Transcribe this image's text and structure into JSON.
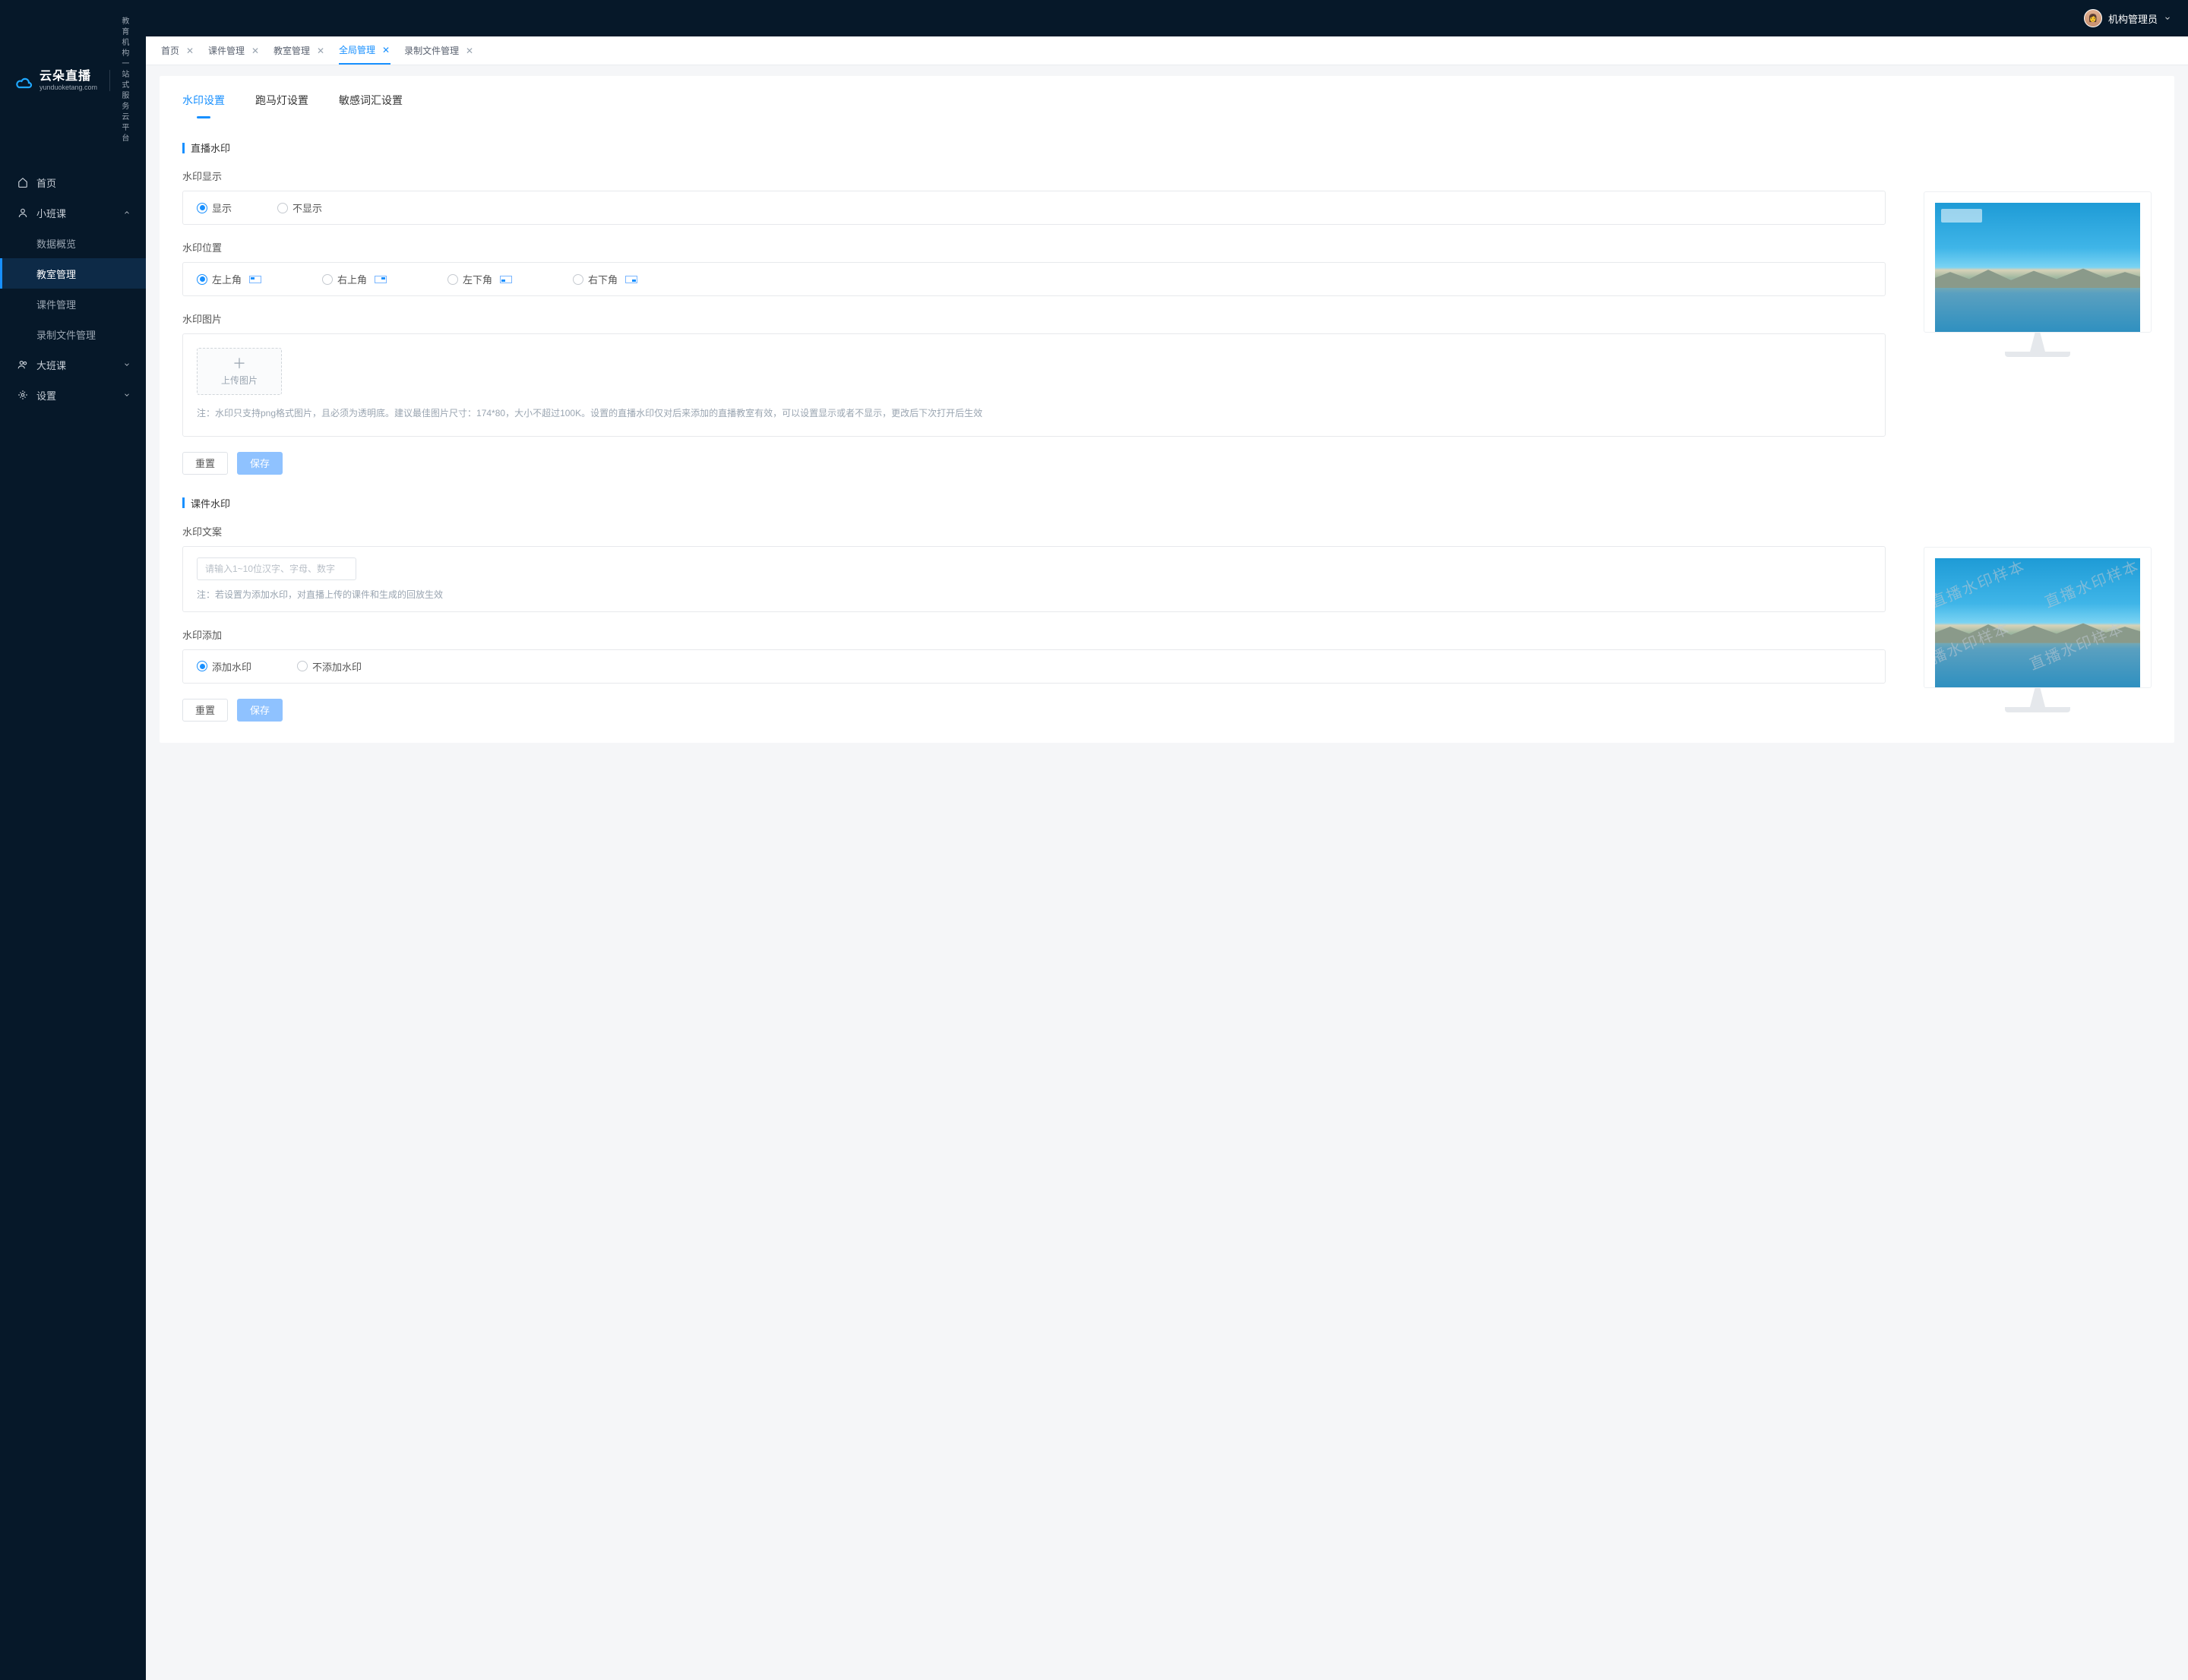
{
  "brand": {
    "name": "云朵直播",
    "domain": "yunduoketang.com",
    "tagline1": "教育机构一站",
    "tagline2": "式服务云平台"
  },
  "user": {
    "name": "机构管理员"
  },
  "sidebar": {
    "items": [
      {
        "label": "首页",
        "icon": "home"
      },
      {
        "label": "小班课",
        "icon": "user",
        "expanded": true,
        "children": [
          {
            "label": "数据概览"
          },
          {
            "label": "教室管理",
            "active": true
          },
          {
            "label": "课件管理"
          },
          {
            "label": "录制文件管理"
          }
        ]
      },
      {
        "label": "大班课",
        "icon": "users",
        "expanded": false
      },
      {
        "label": "设置",
        "icon": "gear",
        "expanded": false
      }
    ]
  },
  "tabs": [
    {
      "label": "首页",
      "active": false
    },
    {
      "label": "课件管理",
      "active": false
    },
    {
      "label": "教室管理",
      "active": false
    },
    {
      "label": "全局管理",
      "active": true
    },
    {
      "label": "录制文件管理",
      "active": false
    }
  ],
  "innerTabs": [
    {
      "label": "水印设置",
      "active": true
    },
    {
      "label": "跑马灯设置",
      "active": false
    },
    {
      "label": "敏感词汇设置",
      "active": false
    }
  ],
  "sections": {
    "live": {
      "title": "直播水印",
      "display": {
        "label": "水印显示",
        "options": [
          "显示",
          "不显示"
        ],
        "selected": 0
      },
      "position": {
        "label": "水印位置",
        "options": [
          "左上角",
          "右上角",
          "左下角",
          "右下角"
        ],
        "selected": 0
      },
      "image": {
        "label": "水印图片",
        "uploadLabel": "上传图片",
        "note": "注：水印只支持png格式图片，且必须为透明底。建议最佳图片尺寸：174*80，大小不超过100K。设置的直播水印仅对后来添加的直播教室有效，可以设置显示或者不显示，更改后下次打开后生效"
      },
      "buttons": {
        "reset": "重置",
        "save": "保存"
      }
    },
    "courseware": {
      "title": "课件水印",
      "text": {
        "label": "水印文案",
        "placeholder": "请输入1~10位汉字、字母、数字",
        "note": "注：若设置为添加水印，对直播上传的课件和生成的回放生效"
      },
      "add": {
        "label": "水印添加",
        "options": [
          "添加水印",
          "不添加水印"
        ],
        "selected": 0
      },
      "buttons": {
        "reset": "重置",
        "save": "保存"
      },
      "sampleText": "直播水印样本"
    }
  }
}
